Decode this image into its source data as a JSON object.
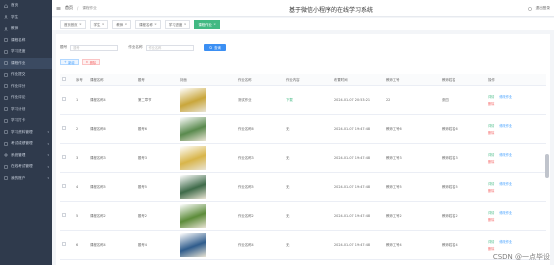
{
  "app_title": "基于微信小程序的在线学习系统",
  "sidebar": {
    "items": [
      {
        "label": "首页",
        "icon": "home-icon"
      },
      {
        "label": "学生",
        "icon": "user-icon"
      },
      {
        "label": "教师",
        "icon": "user-icon"
      },
      {
        "label": "课程名称",
        "icon": "book-icon"
      },
      {
        "label": "学习进度",
        "icon": "chart-icon"
      },
      {
        "label": "课程作业",
        "icon": "file-icon"
      },
      {
        "label": "作业提交",
        "icon": "upload-icon"
      },
      {
        "label": "作业评分",
        "icon": "star-icon"
      },
      {
        "label": "作业评论",
        "icon": "comment-icon"
      },
      {
        "label": "学习计划",
        "icon": "calendar-icon"
      },
      {
        "label": "学习打卡",
        "icon": "check-icon"
      },
      {
        "label": "学习资料管理",
        "icon": "folder-icon"
      },
      {
        "label": "考试成绩管理",
        "icon": "grade-icon"
      },
      {
        "label": "系统管理",
        "icon": "gear-icon"
      },
      {
        "label": "在线考试管理",
        "icon": "exam-icon"
      },
      {
        "label": "我的账户",
        "icon": "account-icon"
      }
    ],
    "active_index": 5
  },
  "header": {
    "breadcrumb_home": "首页",
    "breadcrumb_current": "课程作业",
    "right_text": "退出登录"
  },
  "tabs": [
    {
      "label": "首页首页"
    },
    {
      "label": "学生"
    },
    {
      "label": "教师"
    },
    {
      "label": "课程名称"
    },
    {
      "label": "学习进度"
    },
    {
      "label": "课程作业",
      "active": true
    }
  ],
  "search": {
    "label1": "题号",
    "placeholder1": "题号",
    "label2": "作业名称",
    "placeholder2": "作业名称",
    "button_label": "查询"
  },
  "ops": {
    "add_label": "新增",
    "delete_label": "删除"
  },
  "table": {
    "headers": [
      "",
      "序号",
      "课程名称",
      "题号",
      "封面",
      "作业名称",
      "作业内容",
      "布置时间",
      "教师工号",
      "教师姓名",
      "操作"
    ],
    "actions": {
      "detail": "详情",
      "edit": "修改作业",
      "remark": "查看",
      "delete": "删除"
    },
    "rows": [
      {
        "index": "1",
        "course": "课程名称4",
        "number": "第二章节",
        "cover_color": "#c9a63b",
        "name": "测试作业",
        "content": "下载",
        "time": "2024-01-07 20:53:21",
        "teacher_no": "22",
        "teacher_name": "张四"
      },
      {
        "index": "2",
        "course": "课程名称6",
        "number": "题号6",
        "cover_color": "#5a8a4e",
        "name": "作业名称6",
        "content": "无",
        "time": "2024-01-07 19:47:48",
        "teacher_no": "教师工号6",
        "teacher_name": "教师姓名6"
      },
      {
        "index": "3",
        "course": "课程名称3",
        "number": "题号3",
        "cover_color": "#d8b54a",
        "name": "作业名称3",
        "content": "无",
        "time": "2024-01-07 19:47:48",
        "teacher_no": "教师工号3",
        "teacher_name": "教师姓名3"
      },
      {
        "index": "4",
        "course": "课程名称5",
        "number": "题号5",
        "cover_color": "#3f6b4a",
        "name": "作业名称5",
        "content": "无",
        "time": "2024-01-07 19:47:48",
        "teacher_no": "教师工号5",
        "teacher_name": "教师姓名5"
      },
      {
        "index": "5",
        "course": "课程名称2",
        "number": "题号2",
        "cover_color": "#5d8c3a",
        "name": "作业名称2",
        "content": "无",
        "time": "2024-01-07 19:47:48",
        "teacher_no": "教师工号2",
        "teacher_name": "教师姓名2"
      },
      {
        "index": "6",
        "course": "课程名称4",
        "number": "题号4",
        "cover_color": "#2f5c8c",
        "name": "作业名称4",
        "content": "无",
        "time": "2024-01-07 19:47:48",
        "teacher_no": "教师工号4",
        "teacher_name": "教师姓名4"
      }
    ]
  },
  "watermark": "CSDN @一点毕设",
  "colors": {
    "sidebar_bg": "#2f3a4c",
    "accent_green": "#42b983",
    "primary_blue": "#3b8ff3",
    "danger_red": "#f56c6c"
  }
}
